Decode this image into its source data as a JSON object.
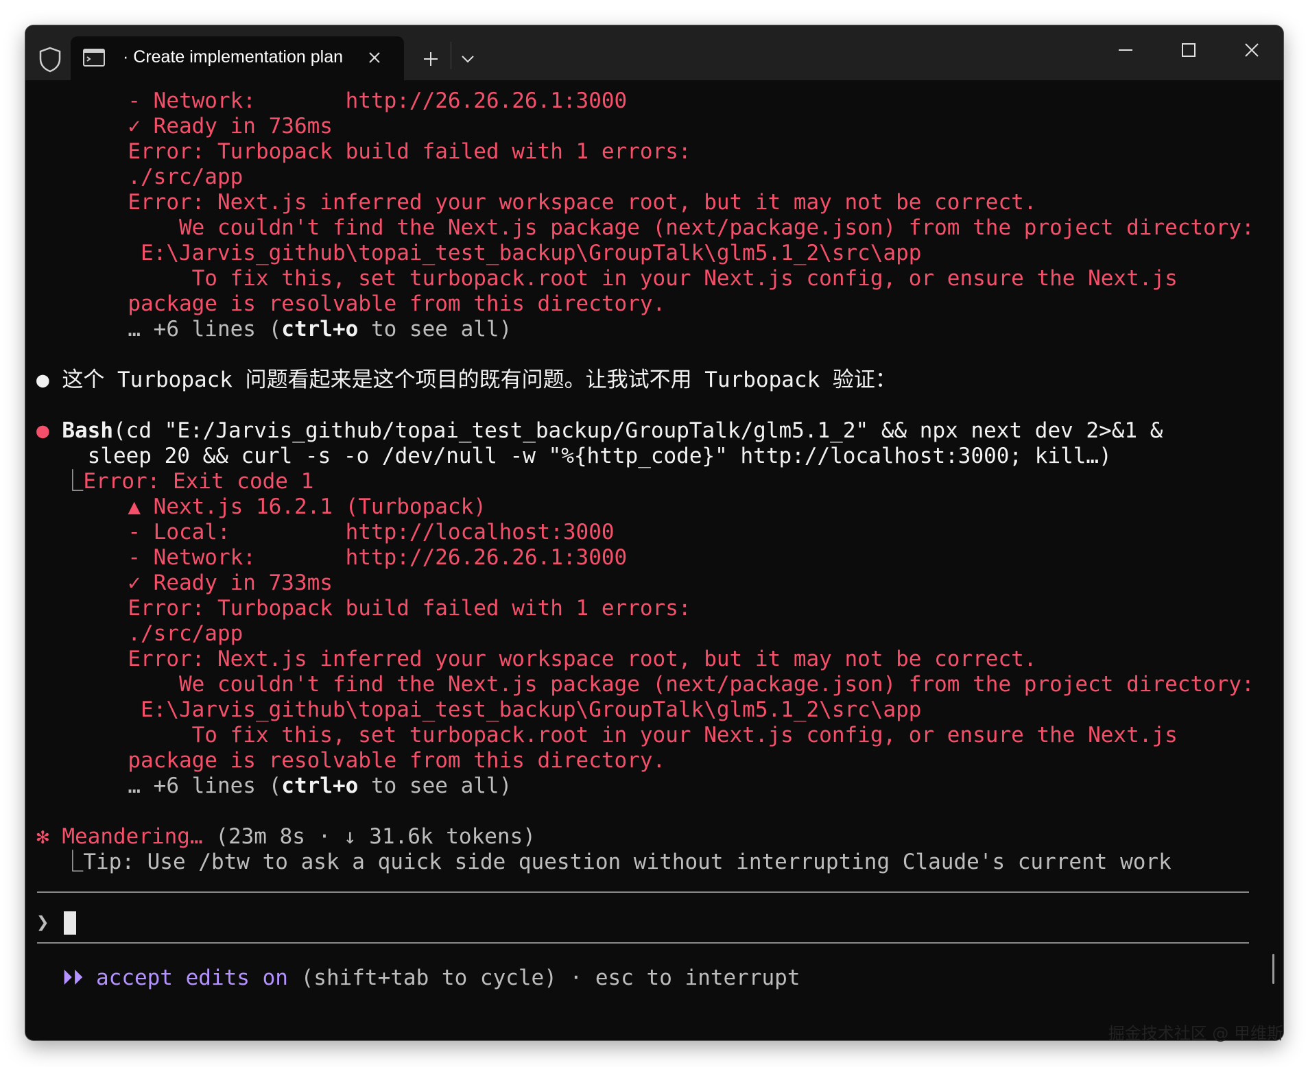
{
  "tab": {
    "title": "· Create implementation plan"
  },
  "colors": {
    "error": "#f4506a",
    "muted": "#bdbdbd",
    "accent": "#b492ff",
    "background": "#0c0c0c",
    "titlebar": "#202020"
  },
  "icons": {
    "shield": "shield-icon",
    "terminal": "terminal-icon",
    "close_tab": "close-icon",
    "new_tab": "plus-icon",
    "dropdown": "chevron-down-icon",
    "minimize": "minimize-icon",
    "maximize": "maximize-icon",
    "close_window": "close-icon"
  },
  "terminal": {
    "block1": {
      "network": "  - Network:       http://26.26.26.1:3000",
      "ready": "  ✓ Ready in 736ms",
      "err1": "  Error: Turbopack build failed with 1 errors:",
      "path": "  ./src/app",
      "err2": "  Error: Next.js inferred your workspace root, but it may not be correct.",
      "detail1": "      We couldn't find the Next.js package (next/package.json) from the project directory:",
      "detail2": "   E:\\Jarvis_github\\topai_test_backup\\GroupTalk\\glm5.1_2\\src\\app",
      "detail3": "       To fix this, set turbopack.root in your Next.js config, or ensure the Next.js",
      "detail4": "  package is resolvable from this directory.",
      "more_prefix": "  … +6 lines (",
      "more_key": "ctrl+o",
      "more_suffix": " to see all)"
    },
    "assistant_bullet": "●",
    "assistant_msg": " 这个 Turbopack 问题看起来是这个项目的既有问题。让我试不用 Turbopack 验证：",
    "bash": {
      "bullet": "●",
      "tool": " Bash",
      "cmd_line1": "(cd \"E:/Jarvis_github/topai_test_backup/GroupTalk/glm5.1_2\" && npx next dev 2>&1 &",
      "cmd_line2": "    sleep 20 && curl -s -o /dev/null -w \"%{http_code}\" http://localhost:3000; kill…)",
      "branch": "  ⎿",
      "exit": "Error: Exit code 1",
      "nextjs": "  ▲ Next.js 16.2.1 (Turbopack)",
      "local": "  - Local:         http://localhost:3000",
      "network": "  - Network:       http://26.26.26.1:3000",
      "ready": "  ✓ Ready in 733ms",
      "err1": "  Error: Turbopack build failed with 1 errors:",
      "path": "  ./src/app",
      "err2": "  Error: Next.js inferred your workspace root, but it may not be correct.",
      "detail1": "      We couldn't find the Next.js package (next/package.json) from the project directory:",
      "detail2": "   E:\\Jarvis_github\\topai_test_backup\\GroupTalk\\glm5.1_2\\src\\app",
      "detail3": "       To fix this, set turbopack.root in your Next.js config, or ensure the Next.js",
      "detail4": "  package is resolvable from this directory.",
      "more_prefix": "  … +6 lines (",
      "more_key": "ctrl+o",
      "more_suffix": " to see all)"
    },
    "status": {
      "spinner": "✻",
      "label": " Meandering…",
      "stats": " (23m 8s · ↓ 31.6k tokens)",
      "tip_branch": "  ⎿",
      "tip": "Tip: Use /btw to ask a quick side question without interrupting Claude's current work"
    },
    "prompt_symbol": "❯",
    "footer": {
      "arrows": "  ⏵⏵",
      "mode": " accept edits on",
      "hint": " (shift+tab to cycle) · esc to interrupt"
    }
  },
  "watermark": "掘金技术社区 @ 甲维斯"
}
